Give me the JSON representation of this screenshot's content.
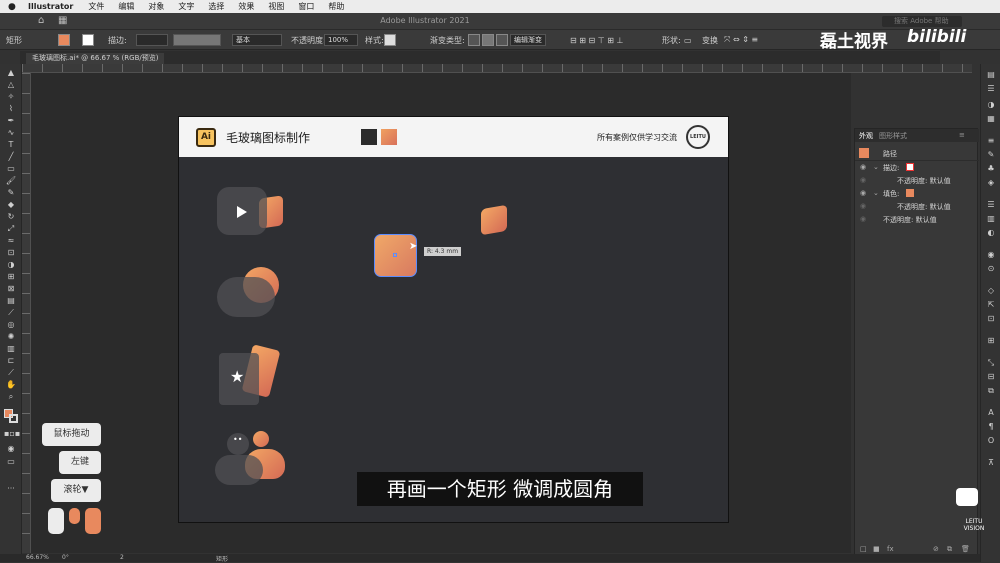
{
  "menubar": {
    "app": "Illustrator",
    "items": [
      "文件",
      "编辑",
      "对象",
      "文字",
      "选择",
      "效果",
      "视图",
      "窗口",
      "帮助"
    ]
  },
  "titlebar": {
    "title": "Adobe Illustrator 2021",
    "search_placeholder": "搜索 Adobe 帮助"
  },
  "control_bar": {
    "tool_name": "矩形",
    "stroke_label": "描边:",
    "stroke_style": "基本",
    "opacity_label": "不透明度:",
    "opacity_value": "100%",
    "style_label": "样式:",
    "gradient_type_label": "渐变类型:",
    "edit_gradient": "编辑渐变",
    "shape_label": "形状:",
    "transform_label": "变换"
  },
  "doc_tab": {
    "label": "毛玻璃图标.ai* @ 66.67 % (RGB/预览)"
  },
  "artboard": {
    "logo": "Ai",
    "title": "毛玻璃图标制作",
    "note": "所有案例仅供学习交流",
    "badge": "LEITU",
    "tooltip": "R: 4.3 mm"
  },
  "subtitle": "再画一个矩形 微调成圆角",
  "keys": {
    "drag": "鼠标拖动",
    "left": "左键",
    "wheel": "滚轮▼"
  },
  "panel": {
    "tab_appearance": "外观",
    "tab_graphic_styles": "图形样式",
    "rows": [
      {
        "label": "路径"
      },
      {
        "label": "描边:"
      },
      {
        "label": "不透明度: 默认值"
      },
      {
        "label": "填色:"
      },
      {
        "label": "不透明度: 默认值"
      },
      {
        "label": "不透明度: 默认值"
      }
    ]
  },
  "status": {
    "zoom": "66.67%",
    "angle": "0°",
    "page": "2",
    "tool": "矩形"
  },
  "watermark": {
    "channel": "磊土视界",
    "site": "bilibili",
    "logo_text": "LEITU VISION"
  },
  "colors": {
    "accent_orange": "#e8895e",
    "dark_bg": "#2e2f33",
    "header_bg": "#f4f4f4"
  }
}
